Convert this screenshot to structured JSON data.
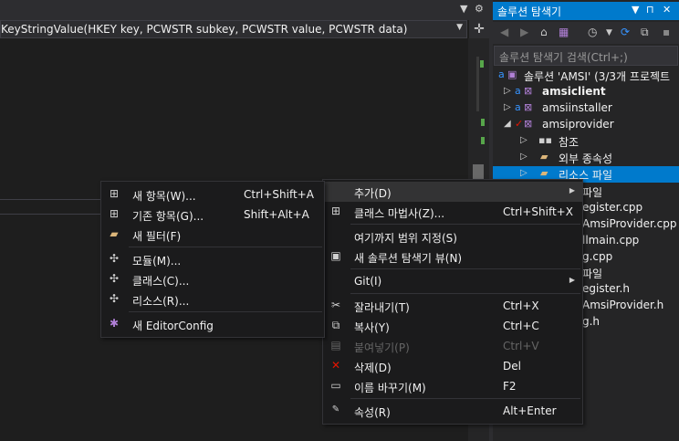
{
  "editor": {
    "nav_text": "KeyStringValue(HKEY key, PCWSTR subkey, PCWSTR value, PCWSTR data)",
    "pin_glyph": "▼",
    "gear_glyph": "⚙",
    "split_glyph": "✛"
  },
  "solution_explorer": {
    "title": "솔루션 탐색기",
    "title_controls": [
      "▼",
      "⊓",
      "✕"
    ],
    "search_placeholder": "솔루션 탐색기 검색(Ctrl+;)",
    "tree": [
      {
        "label": "솔루션 'AMSI' (3/3개 프로젝트",
        "twisty": "",
        "bold": false,
        "selected": false
      },
      {
        "label": "amsiclient",
        "twisty": "▷",
        "bold": true,
        "selected": false
      },
      {
        "label": "amsiinstaller",
        "twisty": "▷",
        "bold": false,
        "selected": false
      },
      {
        "label": "amsiprovider",
        "twisty": "◢",
        "bold": false,
        "selected": false
      },
      {
        "label": "참조",
        "twisty": "▷",
        "bold": false,
        "selected": false
      },
      {
        "label": "외부 종속성",
        "twisty": "▷",
        "bold": false,
        "selected": false
      },
      {
        "label": "리소스 파일",
        "twisty": "▷",
        "bold": false,
        "selected": true
      },
      {
        "label": "파일",
        "twisty": "",
        "bold": false,
        "selected": false
      },
      {
        "label": "egister.cpp",
        "twisty": "",
        "bold": false,
        "selected": false
      },
      {
        "label": "AmsiProvider.cpp",
        "twisty": "",
        "bold": false,
        "selected": false
      },
      {
        "label": "llmain.cpp",
        "twisty": "",
        "bold": false,
        "selected": false
      },
      {
        "label": "g.cpp",
        "twisty": "",
        "bold": false,
        "selected": false
      },
      {
        "label": "파일",
        "twisty": "",
        "bold": false,
        "selected": false
      },
      {
        "label": "egister.h",
        "twisty": "",
        "bold": false,
        "selected": false
      },
      {
        "label": "AmsiProvider.h",
        "twisty": "",
        "bold": false,
        "selected": false
      },
      {
        "label": "g.h",
        "twisty": "",
        "bold": false,
        "selected": false
      }
    ]
  },
  "submenu_add": {
    "items": [
      {
        "label": "새 항목(W)...",
        "shortcut": "Ctrl+Shift+A",
        "icon": "new-item-icon",
        "glyph": "⊞"
      },
      {
        "label": "기존 항목(G)...",
        "shortcut": "Shift+Alt+A",
        "icon": "existing-item-icon",
        "glyph": "⊞"
      },
      {
        "label": "새 필터(F)",
        "shortcut": "",
        "icon": "new-filter-icon",
        "glyph": "▰"
      },
      {
        "label": "모듈(M)...",
        "shortcut": "",
        "icon": "module-icon",
        "glyph": "✣"
      },
      {
        "label": "클래스(C)...",
        "shortcut": "",
        "icon": "class-icon",
        "glyph": "✣"
      },
      {
        "label": "리소스(R)...",
        "shortcut": "",
        "icon": "resource-icon",
        "glyph": "✣"
      },
      {
        "label": "새 EditorConfig",
        "shortcut": "",
        "icon": "editorconfig-icon",
        "glyph": "✱"
      }
    ]
  },
  "context_menu": {
    "items": [
      {
        "label": "추가(D)",
        "shortcut": "",
        "icon": "",
        "glyph": "",
        "submenu": true,
        "disabled": false
      },
      {
        "label": "클래스 마법사(Z)...",
        "shortcut": "Ctrl+Shift+X",
        "icon": "class-wizard-icon",
        "glyph": "⊞",
        "submenu": false,
        "disabled": false
      },
      {
        "label": "여기까지 범위 지정(S)",
        "shortcut": "",
        "icon": "",
        "glyph": "",
        "submenu": false,
        "disabled": false
      },
      {
        "label": "새 솔루션 탐색기 뷰(N)",
        "shortcut": "",
        "icon": "new-explorer-view-icon",
        "glyph": "▣",
        "submenu": false,
        "disabled": false
      },
      {
        "label": "Git(I)",
        "shortcut": "",
        "icon": "",
        "glyph": "",
        "submenu": true,
        "disabled": false
      },
      {
        "label": "잘라내기(T)",
        "shortcut": "Ctrl+X",
        "icon": "scissors-icon",
        "glyph": "✂",
        "submenu": false,
        "disabled": false
      },
      {
        "label": "복사(Y)",
        "shortcut": "Ctrl+C",
        "icon": "copy-icon",
        "glyph": "⧉",
        "submenu": false,
        "disabled": false
      },
      {
        "label": "붙여넣기(P)",
        "shortcut": "Ctrl+V",
        "icon": "paste-icon",
        "glyph": "▤",
        "submenu": false,
        "disabled": true
      },
      {
        "label": "삭제(D)",
        "shortcut": "Del",
        "icon": "delete-icon",
        "glyph": "✕",
        "submenu": false,
        "disabled": false
      },
      {
        "label": "이름 바꾸기(M)",
        "shortcut": "F2",
        "icon": "rename-icon",
        "glyph": "▭",
        "submenu": false,
        "disabled": false
      },
      {
        "label": "속성(R)",
        "shortcut": "Alt+Enter",
        "icon": "wrench-icon",
        "glyph": "🔧",
        "submenu": false,
        "disabled": false
      }
    ]
  },
  "colors": {
    "accent": "#007acc",
    "delete": "#e51400",
    "editorconfig": "#b180d7",
    "folder": "#dcb67a"
  }
}
